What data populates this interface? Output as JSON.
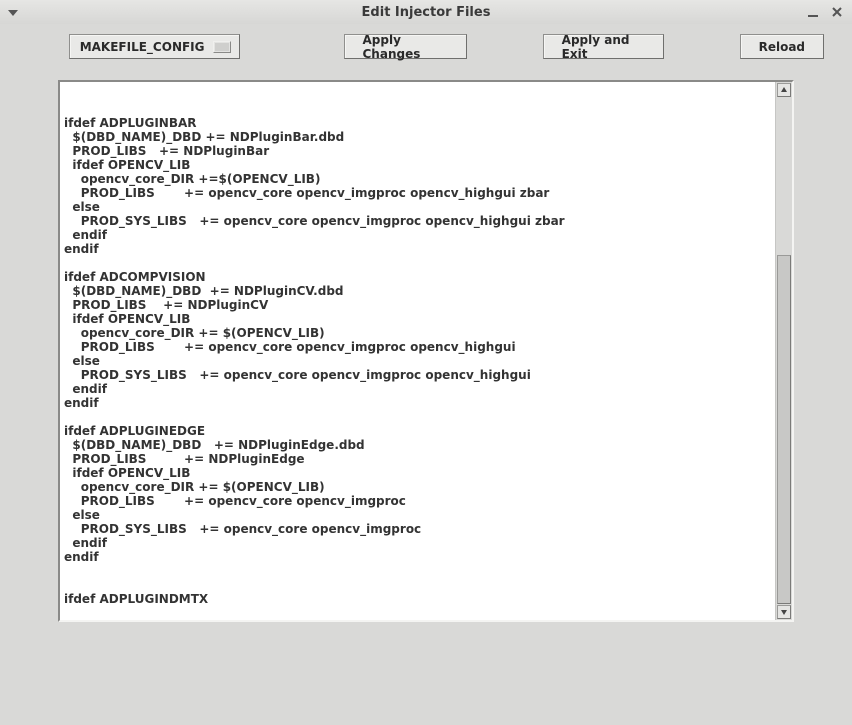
{
  "window": {
    "title": "Edit Injector Files"
  },
  "toolbar": {
    "dropdown": {
      "selected": "MAKEFILE_CONFIG"
    },
    "apply_changes_label": "Apply Changes",
    "apply_exit_label": "Apply and Exit",
    "reload_label": "Reload"
  },
  "editor": {
    "content": "\n\nifdef ADPLUGINBAR\n  $(DBD_NAME)_DBD += NDPluginBar.dbd\n  PROD_LIBS   += NDPluginBar\n  ifdef OPENCV_LIB\n    opencv_core_DIR +=$(OPENCV_LIB)\n    PROD_LIBS       += opencv_core opencv_imgproc opencv_highgui zbar\n  else\n    PROD_SYS_LIBS   += opencv_core opencv_imgproc opencv_highgui zbar\n  endif\nendif\n\nifdef ADCOMPVISION\n  $(DBD_NAME)_DBD  += NDPluginCV.dbd\n  PROD_LIBS    += NDPluginCV\n  ifdef OPENCV_LIB\n    opencv_core_DIR += $(OPENCV_LIB)\n    PROD_LIBS       += opencv_core opencv_imgproc opencv_highgui\n  else\n    PROD_SYS_LIBS   += opencv_core opencv_imgproc opencv_highgui\n  endif\nendif\n\nifdef ADPLUGINEDGE\n  $(DBD_NAME)_DBD   += NDPluginEdge.dbd\n  PROD_LIBS         += NDPluginEdge\n  ifdef OPENCV_LIB\n    opencv_core_DIR += $(OPENCV_LIB)\n    PROD_LIBS       += opencv_core opencv_imgproc\n  else\n    PROD_SYS_LIBS   += opencv_core opencv_imgproc\n  endif\nendif\n\n\nifdef ADPLUGINDMTX"
  },
  "scrollbar": {
    "thumb_top_pct": 31,
    "thumb_height_pct": 69
  }
}
